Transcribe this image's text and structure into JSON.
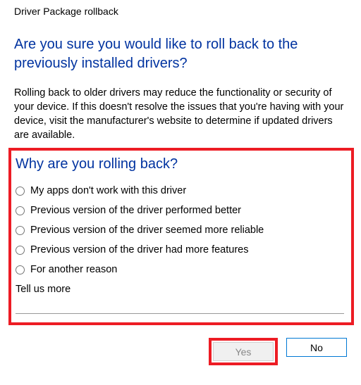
{
  "window": {
    "title": "Driver Package rollback"
  },
  "heading": "Are you sure you would like to roll back to the previously installed drivers?",
  "body": "Rolling back to older drivers may reduce the functionality or security of your device. If this doesn't resolve the issues that you're having with your device, visit the manufacturer's website to determine if updated drivers are available.",
  "section": {
    "subheading": "Why are you rolling back?",
    "reasons": [
      "My apps don't work with this driver",
      "Previous version of the driver performed better",
      "Previous version of the driver seemed more reliable",
      "Previous version of the driver had more features",
      "For another reason"
    ],
    "tell_more": "Tell us more",
    "input_value": ""
  },
  "buttons": {
    "yes": "Yes",
    "no": "No"
  },
  "highlight_color": "#ed1c24"
}
